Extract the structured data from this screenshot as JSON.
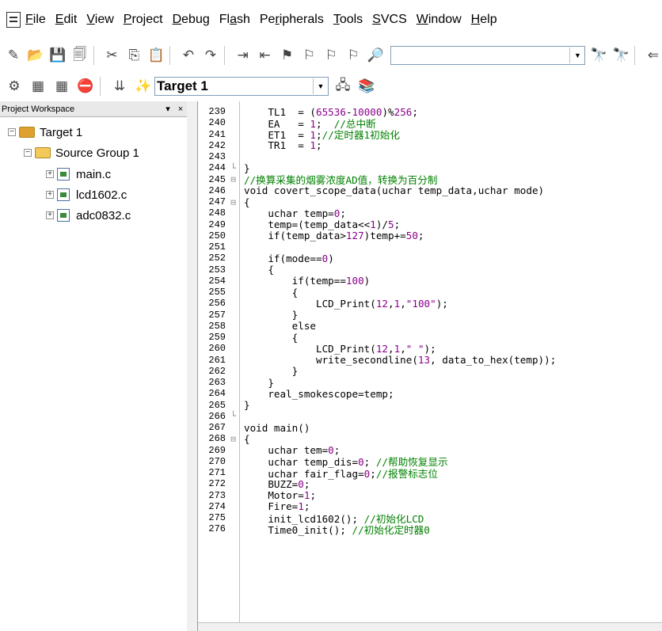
{
  "menu": {
    "items": [
      {
        "id": "file",
        "pre": "",
        "u": "F",
        "post": "ile"
      },
      {
        "id": "edit",
        "pre": "",
        "u": "E",
        "post": "dit"
      },
      {
        "id": "view",
        "pre": "",
        "u": "V",
        "post": "iew"
      },
      {
        "id": "project",
        "pre": "",
        "u": "P",
        "post": "roject"
      },
      {
        "id": "debug",
        "pre": "",
        "u": "D",
        "post": "ebug"
      },
      {
        "id": "flash",
        "pre": "Fl",
        "u": "a",
        "post": "sh"
      },
      {
        "id": "peripherals",
        "pre": "Pe",
        "u": "r",
        "post": "ipherals"
      },
      {
        "id": "tools",
        "pre": "",
        "u": "T",
        "post": "ools"
      },
      {
        "id": "svcs",
        "pre": "",
        "u": "S",
        "post": "VCS"
      },
      {
        "id": "window",
        "pre": "",
        "u": "W",
        "post": "indow"
      },
      {
        "id": "help",
        "pre": "",
        "u": "H",
        "post": "elp"
      }
    ]
  },
  "toolbar": {
    "find_value": "",
    "target_value": "Target 1"
  },
  "workspace": {
    "title": "Project Workspace",
    "pin": "▾",
    "close": "×",
    "target": "Target 1",
    "group": "Source Group 1",
    "files": [
      "main.c",
      "lcd1602.c",
      "adc0832.c"
    ]
  },
  "editor": {
    "lines": [
      {
        "n": "239",
        "f": "",
        "c": "TL1  = (65536-10000)%256;",
        "ind": "    "
      },
      {
        "n": "240",
        "f": "",
        "c": "EA   = 1;  //总中断",
        "ind": "    "
      },
      {
        "n": "241",
        "f": "",
        "c": "ET1  = 1;//定时器1初始化",
        "ind": "    "
      },
      {
        "n": "242",
        "f": "",
        "c": "TR1  = 1;",
        "ind": "    "
      },
      {
        "n": "243",
        "f": "",
        "c": "",
        "ind": ""
      },
      {
        "n": "244",
        "f": "└",
        "c": "}",
        "ind": ""
      },
      {
        "n": "245",
        "f": "⊟",
        "c": "//换算采集的烟雾浓度AD值，转换为百分制",
        "ind": ""
      },
      {
        "n": "246",
        "f": "",
        "c": "void covert_scope_data(uchar temp_data,uchar mode)",
        "ind": ""
      },
      {
        "n": "247",
        "f": "⊟",
        "c": "{",
        "ind": ""
      },
      {
        "n": "248",
        "f": "",
        "c": "uchar temp=0;",
        "ind": "    "
      },
      {
        "n": "249",
        "f": "",
        "c": "temp=(temp_data<<1)/5;",
        "ind": "    "
      },
      {
        "n": "250",
        "f": "",
        "c": "if(temp_data>127)temp+=50;",
        "ind": "    "
      },
      {
        "n": "251",
        "f": "",
        "c": "",
        "ind": ""
      },
      {
        "n": "252",
        "f": "",
        "c": "if(mode==0)",
        "ind": "    "
      },
      {
        "n": "253",
        "f": "",
        "c": "{",
        "ind": "    "
      },
      {
        "n": "254",
        "f": "",
        "c": "if(temp==100)",
        "ind": "        "
      },
      {
        "n": "255",
        "f": "",
        "c": "{",
        "ind": "        "
      },
      {
        "n": "256",
        "f": "",
        "c": "LCD_Print(12,1,\"100\");",
        "ind": "            "
      },
      {
        "n": "257",
        "f": "",
        "c": "}",
        "ind": "        "
      },
      {
        "n": "258",
        "f": "",
        "c": "else",
        "ind": "        "
      },
      {
        "n": "259",
        "f": "",
        "c": "{",
        "ind": "        "
      },
      {
        "n": "260",
        "f": "",
        "c": "LCD_Print(12,1,\" \");",
        "ind": "            "
      },
      {
        "n": "261",
        "f": "",
        "c": "write_secondline(13, data_to_hex(temp));",
        "ind": "            "
      },
      {
        "n": "262",
        "f": "",
        "c": "}",
        "ind": "        "
      },
      {
        "n": "263",
        "f": "",
        "c": "}",
        "ind": "    "
      },
      {
        "n": "264",
        "f": "",
        "c": "real_smokescope=temp;",
        "ind": "    "
      },
      {
        "n": "265",
        "f": "",
        "c": "}",
        "ind": ""
      },
      {
        "n": "266",
        "f": "└",
        "c": "",
        "ind": ""
      },
      {
        "n": "267",
        "f": "",
        "c": "void main()",
        "ind": ""
      },
      {
        "n": "268",
        "f": "⊟",
        "c": "{",
        "ind": ""
      },
      {
        "n": "269",
        "f": "",
        "c": "uchar tem=0;",
        "ind": "    "
      },
      {
        "n": "270",
        "f": "",
        "c": "uchar temp_dis=0; //帮助恢复显示",
        "ind": "    "
      },
      {
        "n": "271",
        "f": "",
        "c": "uchar fair_flag=0;//报警标志位",
        "ind": "    "
      },
      {
        "n": "272",
        "f": "",
        "c": "BUZZ=0;",
        "ind": "    "
      },
      {
        "n": "273",
        "f": "",
        "c": "Motor=1;",
        "ind": "    "
      },
      {
        "n": "274",
        "f": "",
        "c": "Fire=1;",
        "ind": "    "
      },
      {
        "n": "275",
        "f": "",
        "c": "init_lcd1602(); //初始化LCD",
        "ind": "    "
      },
      {
        "n": "276",
        "f": "",
        "c": "Time0_init(); //初始化定时器0",
        "ind": "    "
      }
    ]
  }
}
